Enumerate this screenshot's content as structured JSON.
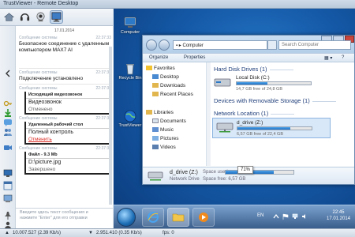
{
  "window": {
    "title": "TrustViewer - Remote Desktop"
  },
  "toolbar": {
    "icons": [
      "home-icon",
      "headset-icon",
      "webcam-icon",
      "monitor-icon"
    ]
  },
  "chat": {
    "date": "17.01.2014",
    "messages": [
      {
        "source": "Сообщение системы",
        "time": "22:37:33",
        "text": "Безопасное соединение с удаленным компьютером MAX7 AI"
      },
      {
        "source": "Сообщение системы",
        "time": "22:37:33",
        "text": "Подключение установлено"
      }
    ],
    "cards": [
      {
        "head_source": "Сообщение системы",
        "time": "22:37:33",
        "title": "Исходящий видеозвонок",
        "body": "Видеозвонок",
        "status": "Отменено",
        "status_red": false
      },
      {
        "head_source": "Сообщение системы",
        "time": "22:37:33",
        "title": "Удаленный рабочий стол",
        "body": "Полный контроль",
        "status": "Отменить",
        "status_red": true
      },
      {
        "head_source": "Сообщение системы",
        "time": "22:37:33",
        "title": "Файл - 9.3 Mb",
        "body": "D:\\picture.jpg",
        "status": "Завершено",
        "status_red": false
      }
    ],
    "input_placeholder": "Введите здесь текст сообщения и нажмите \"Enter\" для его отправки"
  },
  "desktop": {
    "icons": [
      {
        "label": "Computer"
      },
      {
        "label": "Recycle Bin"
      },
      {
        "label": "TrustViewer"
      }
    ]
  },
  "explorer": {
    "address": "Computer",
    "search_placeholder": "Search Computer",
    "commands": {
      "organize": "Organize",
      "properties": "Properties"
    },
    "nav": [
      {
        "label": "Favorites",
        "level": 0
      },
      {
        "label": "Desktop",
        "level": 1
      },
      {
        "label": "Downloads",
        "level": 1
      },
      {
        "label": "Recent Places",
        "level": 1
      },
      {
        "label": "Libraries",
        "level": 0
      },
      {
        "label": "Documents",
        "level": 1
      },
      {
        "label": "Music",
        "level": 1
      },
      {
        "label": "Pictures",
        "level": 1
      },
      {
        "label": "Videos",
        "level": 1
      }
    ],
    "groups": {
      "hdd": "Hard Disk Drives (1)",
      "removable": "Devices with Removable Storage (1)",
      "network": "Network Location (1)"
    },
    "drives": {
      "local": {
        "name": "Local Disk (C:)",
        "free": "14,7 GB free of 24,8 GB",
        "used_fraction": 0.41
      },
      "net": {
        "name": "d_drive (Z:)",
        "free": "6,57 GB free of 22,4 GB",
        "used_fraction": 0.71
      }
    },
    "details": {
      "name": "d_drive (Z:)",
      "type": "Network Drive",
      "space_used_label": "Space used:",
      "space_free_label": "Space free:",
      "space_free_value": "6,57 GB",
      "tooltip": "71%",
      "used_fraction": 0.71
    }
  },
  "taskbar": {
    "lang": "EN",
    "time": "22:45",
    "date": "17.01.2014"
  },
  "statusbar": {
    "left": "10.007.527 (2.39 Kb/s)",
    "right": "2.951.410 (0.35 Kb/s)",
    "fps": "fps: 0"
  }
}
